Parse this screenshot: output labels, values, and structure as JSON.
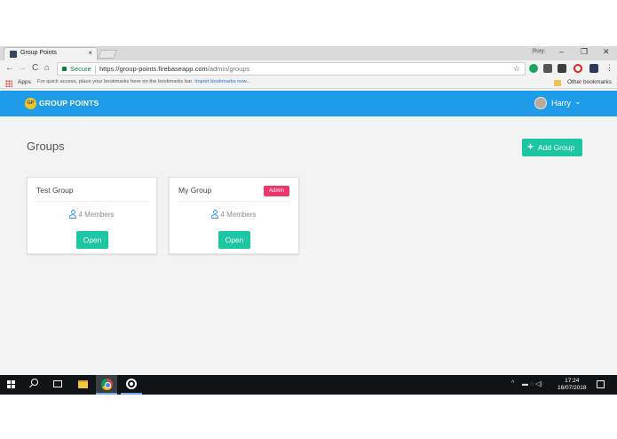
{
  "browser": {
    "tab_title": "Group Points",
    "tab_close": "×",
    "profile_name": "Rory",
    "minimize": "–",
    "restore": "❐",
    "close": "✕",
    "back": "←",
    "forward": "→",
    "reload": "C",
    "home": "⌂",
    "secure_label": "Secure",
    "url_host": "https://group-points.firebaseapp.com",
    "url_path": "/admin/groups",
    "star": "☆",
    "menu": "⋮"
  },
  "bookmarks": {
    "apps_label": "Apps",
    "hint": "For quick access, place your bookmarks here on the bookmarks bar.",
    "import_link": "Import bookmarks now...",
    "other_label": "Other bookmarks"
  },
  "app": {
    "logo_mark": "GP",
    "logo_text": "GROUP POINTS",
    "user_name": "Harry",
    "chevron": "⌄",
    "accent_color": "#1e9be9",
    "button_color": "#1cc6a3",
    "badge_color": "#f0356b"
  },
  "page": {
    "title": "Groups",
    "add_button_plus": "+",
    "add_button_label": "Add Group"
  },
  "groups": [
    {
      "name": "Test Group",
      "members": "4 Members",
      "open_label": "Open",
      "badge": ""
    },
    {
      "name": "My Group",
      "members": "4 Members",
      "open_label": "Open",
      "badge": "Admin"
    }
  ],
  "taskbar": {
    "tray_arrow": "^",
    "tray_icons": "▬ ◌ ◁)",
    "time": "17:24",
    "date": "16/07/2018"
  }
}
